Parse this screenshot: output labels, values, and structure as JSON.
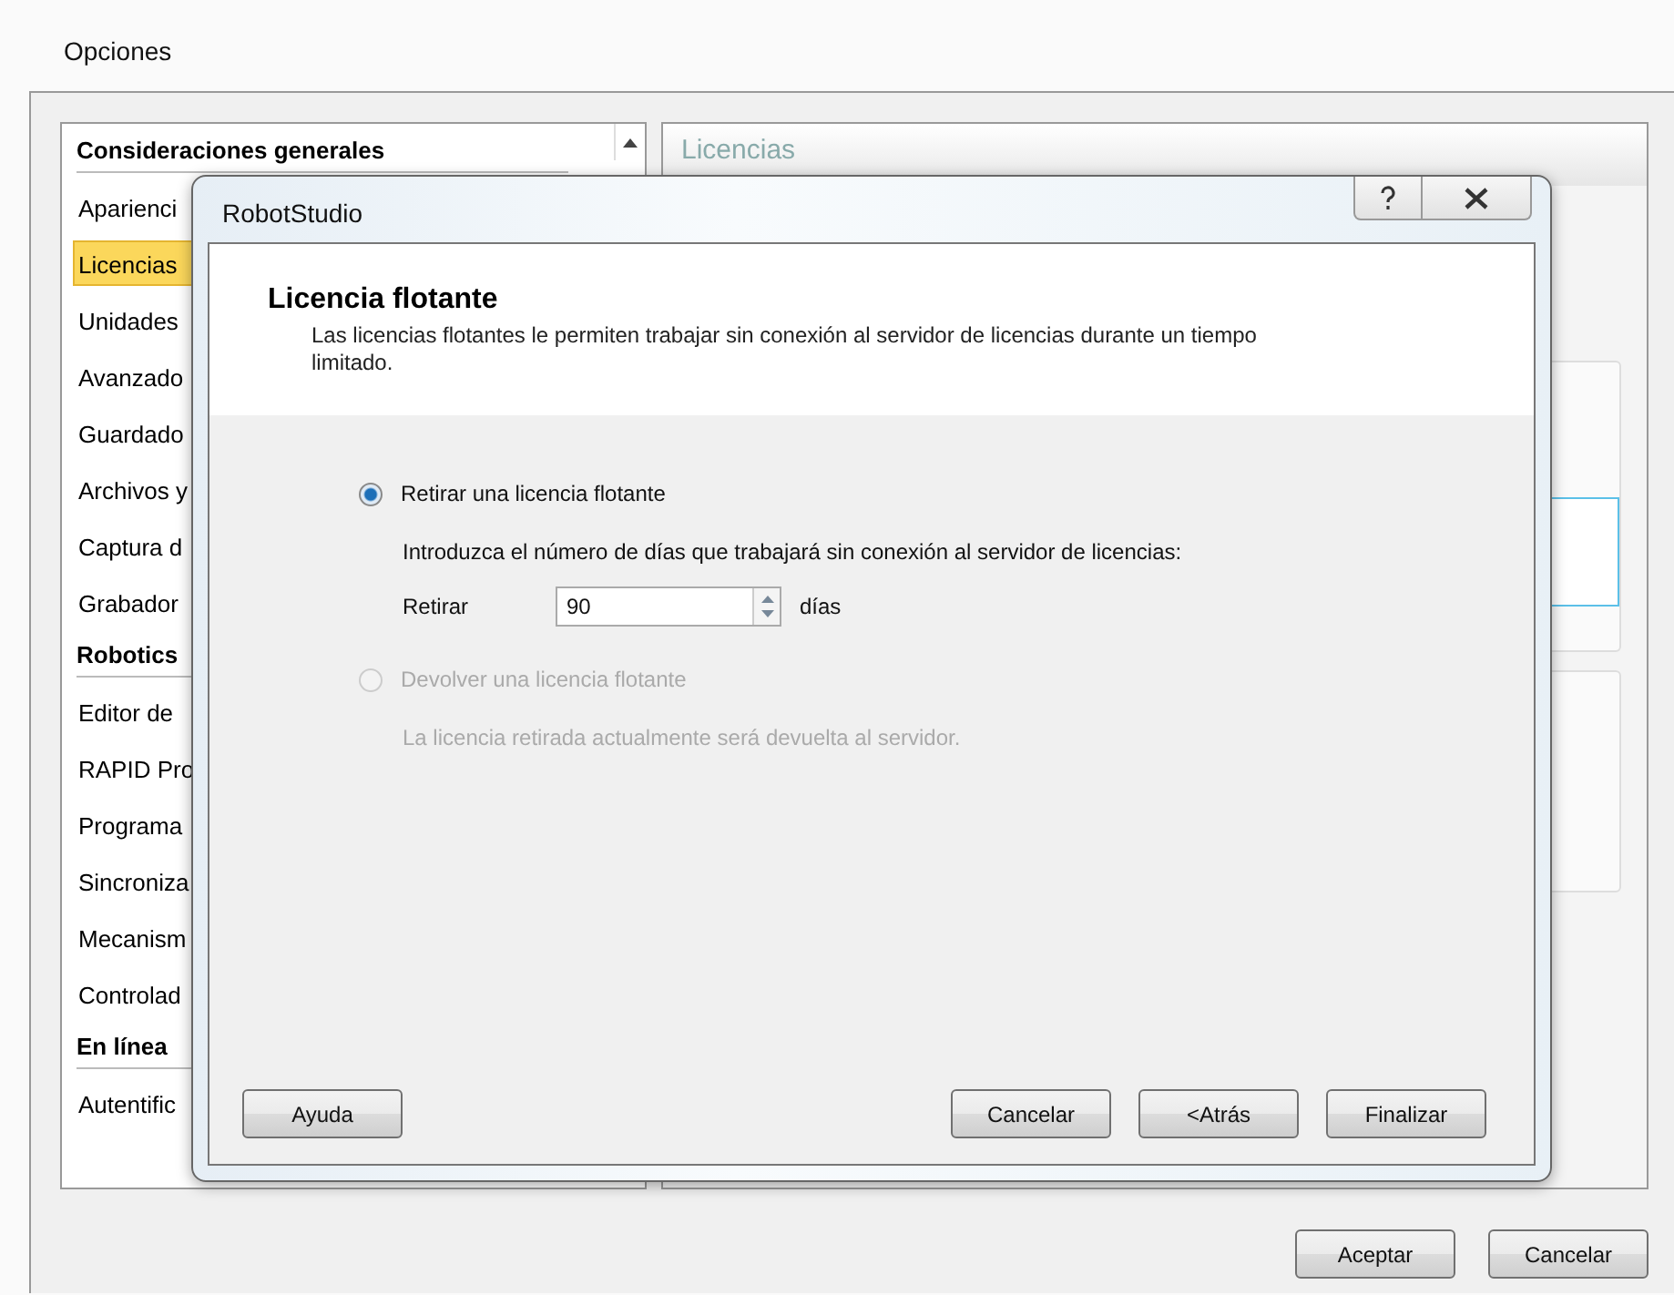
{
  "window": {
    "title": "Opciones"
  },
  "sidebar": {
    "groups": [
      {
        "heading": "Consideraciones generales",
        "items": [
          {
            "label": "Aparienci",
            "selected": false
          },
          {
            "label": "Licencias",
            "selected": true
          },
          {
            "label": "Unidades",
            "selected": false
          },
          {
            "label": "Avanzado",
            "selected": false
          },
          {
            "label": "Guardado",
            "selected": false
          },
          {
            "label": "Archivos y",
            "selected": false
          },
          {
            "label": "Captura d",
            "selected": false
          },
          {
            "label": "Grabador",
            "selected": false
          }
        ]
      },
      {
        "heading": "Robotics",
        "items": [
          {
            "label": "Editor de",
            "selected": false
          },
          {
            "label": "RAPID Pro",
            "selected": false
          },
          {
            "label": "Programa",
            "selected": false
          },
          {
            "label": "Sincroniza",
            "selected": false
          },
          {
            "label": "Mecanism",
            "selected": false
          },
          {
            "label": "Controlad",
            "selected": false
          }
        ]
      },
      {
        "heading": "En línea",
        "items": [
          {
            "label": "Autentific",
            "selected": false
          }
        ]
      }
    ]
  },
  "panel": {
    "title": "Licencias"
  },
  "dialog": {
    "title": "RobotStudio",
    "heading": "Licencia flotante",
    "description": "Las licencias flotantes le permiten trabajar sin conexión al servidor de licencias durante un tiempo limitado.",
    "options": [
      {
        "label": "Retirar una licencia flotante",
        "selected": true,
        "disabled": false,
        "detail": "Introduzca el número de días que trabajará sin conexión al servidor de licencias:",
        "days": {
          "label": "Retirar",
          "value": "90",
          "unit": "días"
        }
      },
      {
        "label": "Devolver una licencia flotante",
        "selected": false,
        "disabled": true,
        "detail": "La licencia retirada actualmente será devuelta al servidor."
      }
    ],
    "help_button": "Ayuda",
    "buttons": [
      "Cancelar",
      "<Atrás",
      "Finalizar"
    ]
  },
  "buttons": [
    "Aceptar",
    "Cancelar"
  ]
}
